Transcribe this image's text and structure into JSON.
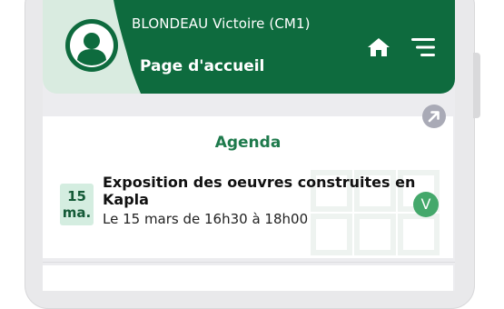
{
  "header": {
    "user_name": "BLONDEAU Victoire (CM1)",
    "page_title": "Page d'accueil",
    "icons": {
      "avatar": "user-icon",
      "home": "home-icon",
      "menu": "menu-icon"
    },
    "colors": {
      "primary": "#0e6b3e",
      "light": "#d9ebe0"
    }
  },
  "agenda": {
    "title": "Agenda",
    "expand_icon": "expand-arrow-icon",
    "events": [
      {
        "day": "15",
        "month": "ma.",
        "title": "Exposition des oeuvres construites en Kapla",
        "time": "Le 15 mars de 16h30 à 18h00",
        "status": "V",
        "status_color": "#44a86b"
      }
    ]
  }
}
